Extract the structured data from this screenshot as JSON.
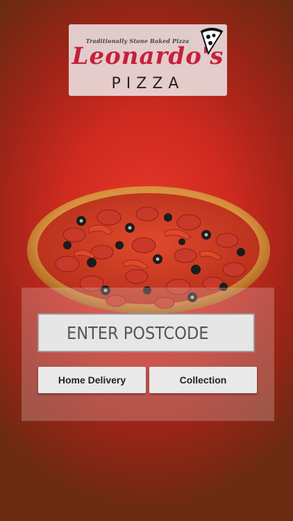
{
  "logo": {
    "tagline": "Traditionally Stone Baked Pizza",
    "name": "Leonardo's",
    "word": "PIZZA",
    "brand_color": "#c81f3b"
  },
  "hero": {
    "image": "pizza-image"
  },
  "search": {
    "placeholder": "ENTER POSTCODE",
    "value": ""
  },
  "actions": {
    "home_delivery": "Home Delivery",
    "collection": "Collection"
  },
  "colors": {
    "background": "#cf2a20",
    "button": "#e9e9e9",
    "input": "#e6e6e6"
  }
}
